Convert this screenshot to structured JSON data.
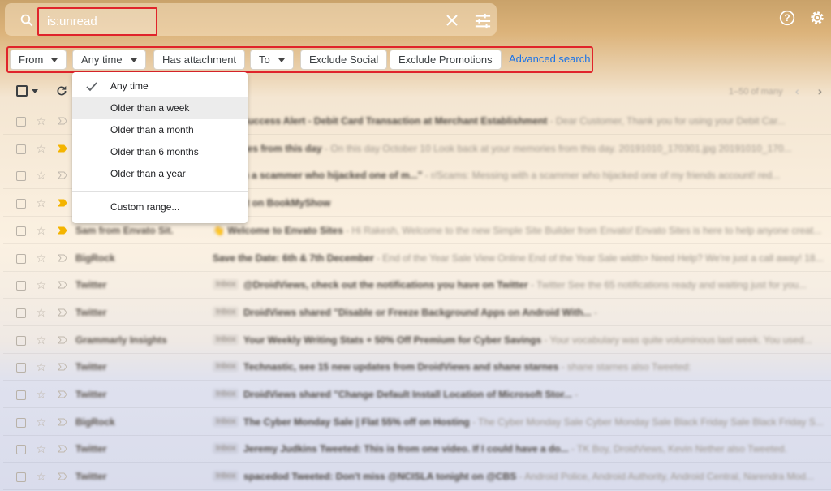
{
  "search": {
    "query": "is:unread"
  },
  "filters": {
    "from": "From",
    "any_time": "Any time",
    "has_attachment": "Has attachment",
    "to": "To",
    "exclude_social": "Exclude Social",
    "exclude_promotions": "Exclude Promotions",
    "advanced_search": "Advanced search"
  },
  "time_dropdown": {
    "items": [
      "Any time",
      "Older than a week",
      "Older than a month",
      "Older than 6 months",
      "Older than a year"
    ],
    "selected": "Any time",
    "custom": "Custom range..."
  },
  "pager": {
    "text": "1–50 of many"
  },
  "emails": [
    {
      "sender": "",
      "tag": "",
      "subject": "...tion Success Alert - Debit Card Transaction at Merchant Establishment",
      "snippet": " - Dear Customer, Thank you for using your Debit Car..."
    },
    {
      "sender": "",
      "tag": "",
      "subject": "...emories from this day",
      "snippet": " - On this day October 10 Look back at your memories from this day. 20191010_170301.jpg 20191010_170..."
    },
    {
      "sender": "",
      "tag": "",
      "subject": "...g with a scammer who hijacked one of m...\"",
      "snippet": " - r/Scams: Messing with a scammer who hijacked one of my friends account! red..."
    },
    {
      "sender": "",
      "tag": "",
      "subject": "...yment on BookMyShow",
      "snippet": ""
    },
    {
      "sender": "Sam from Envato Sit.",
      "tag": "",
      "subject": "👋 Welcome to Envato Sites",
      "snippet": " - Hi Rakesh, Welcome to the new Simple Site Builder from Envato! Envato Sites is here to help anyone creat..."
    },
    {
      "sender": "BigRock",
      "tag": "",
      "subject": "Save the Date: 6th & 7th December",
      "snippet": " - End of the Year Sale View Online End of the Year Sale width> Need Help? We're just a call away! 18..."
    },
    {
      "sender": "Twitter",
      "tag": "Inbox",
      "subject": "@DroidViews, check out the notifications you have on Twitter",
      "snippet": " - Twitter See the 65 notifications ready and waiting just for you..."
    },
    {
      "sender": "Twitter",
      "tag": "Inbox",
      "subject": "DroidViews shared \"Disable or Freeze Background Apps on Android With...",
      "snippet": " - "
    },
    {
      "sender": "Grammarly Insights",
      "tag": "Inbox",
      "subject": "Your Weekly Writing Stats + 50% Off Premium for Cyber Savings",
      "snippet": " - Your vocabulary was quite voluminous last week. You used..."
    },
    {
      "sender": "Twitter",
      "tag": "Inbox",
      "subject": "Technastic, see 15 new updates from DroidViews and shane starnes",
      "snippet": " - shane starnes also Tweeted:"
    },
    {
      "sender": "Twitter",
      "tag": "Inbox",
      "subject": "DroidViews shared \"Change Default Install Location of Microsoft Stor...",
      "snippet": " - "
    },
    {
      "sender": "BigRock",
      "tag": "Inbox",
      "subject": "The Cyber Monday Sale | Flat 55% off on Hosting",
      "snippet": " - The Cyber Monday Sale Cyber Monday Sale Black Friday Sale Black Friday S..."
    },
    {
      "sender": "Twitter",
      "tag": "Inbox",
      "subject": "Jeremy Judkins Tweeted: This is from one video. If I could have a do...",
      "snippet": " - TK Boy, DroidViews, Kevin Nether also Tweeted."
    },
    {
      "sender": "Twitter",
      "tag": "Inbox",
      "subject": "spacedod Tweeted: Don't miss @NCISLA tonight on @CBS",
      "snippet": " - Android Police, Android Authority, Android Central, Narendra Mod..."
    }
  ]
}
